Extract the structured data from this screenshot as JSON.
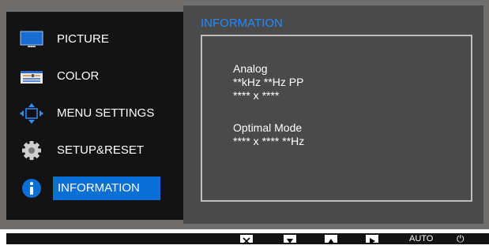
{
  "menu": {
    "items": [
      {
        "label": "PICTURE",
        "icon": "monitor-icon"
      },
      {
        "label": "COLOR",
        "icon": "color-icon"
      },
      {
        "label": "MENU SETTINGS",
        "icon": "move-arrows-icon"
      },
      {
        "label": "SETUP&RESET",
        "icon": "gear-icon"
      },
      {
        "label": "INFORMATION",
        "icon": "info-icon",
        "active": true
      }
    ]
  },
  "content": {
    "title": "INFORMATION",
    "lines": {
      "signal_type": "Analog",
      "frequency": "**kHz **Hz PP",
      "resolution": "**** x ****",
      "optimal_label": "Optimal Mode",
      "optimal_value": "**** x **** **Hz"
    }
  },
  "bottom_bar": {
    "keys": [
      "close-key",
      "down-key",
      "up-key",
      "right-key"
    ],
    "auto_label": "AUTO",
    "power_glyph": "⏻"
  },
  "colors": {
    "accent": "#0a6fd6",
    "title": "#1f8bff",
    "panel_bg": "#131313",
    "frame": "#6e6d6b"
  }
}
